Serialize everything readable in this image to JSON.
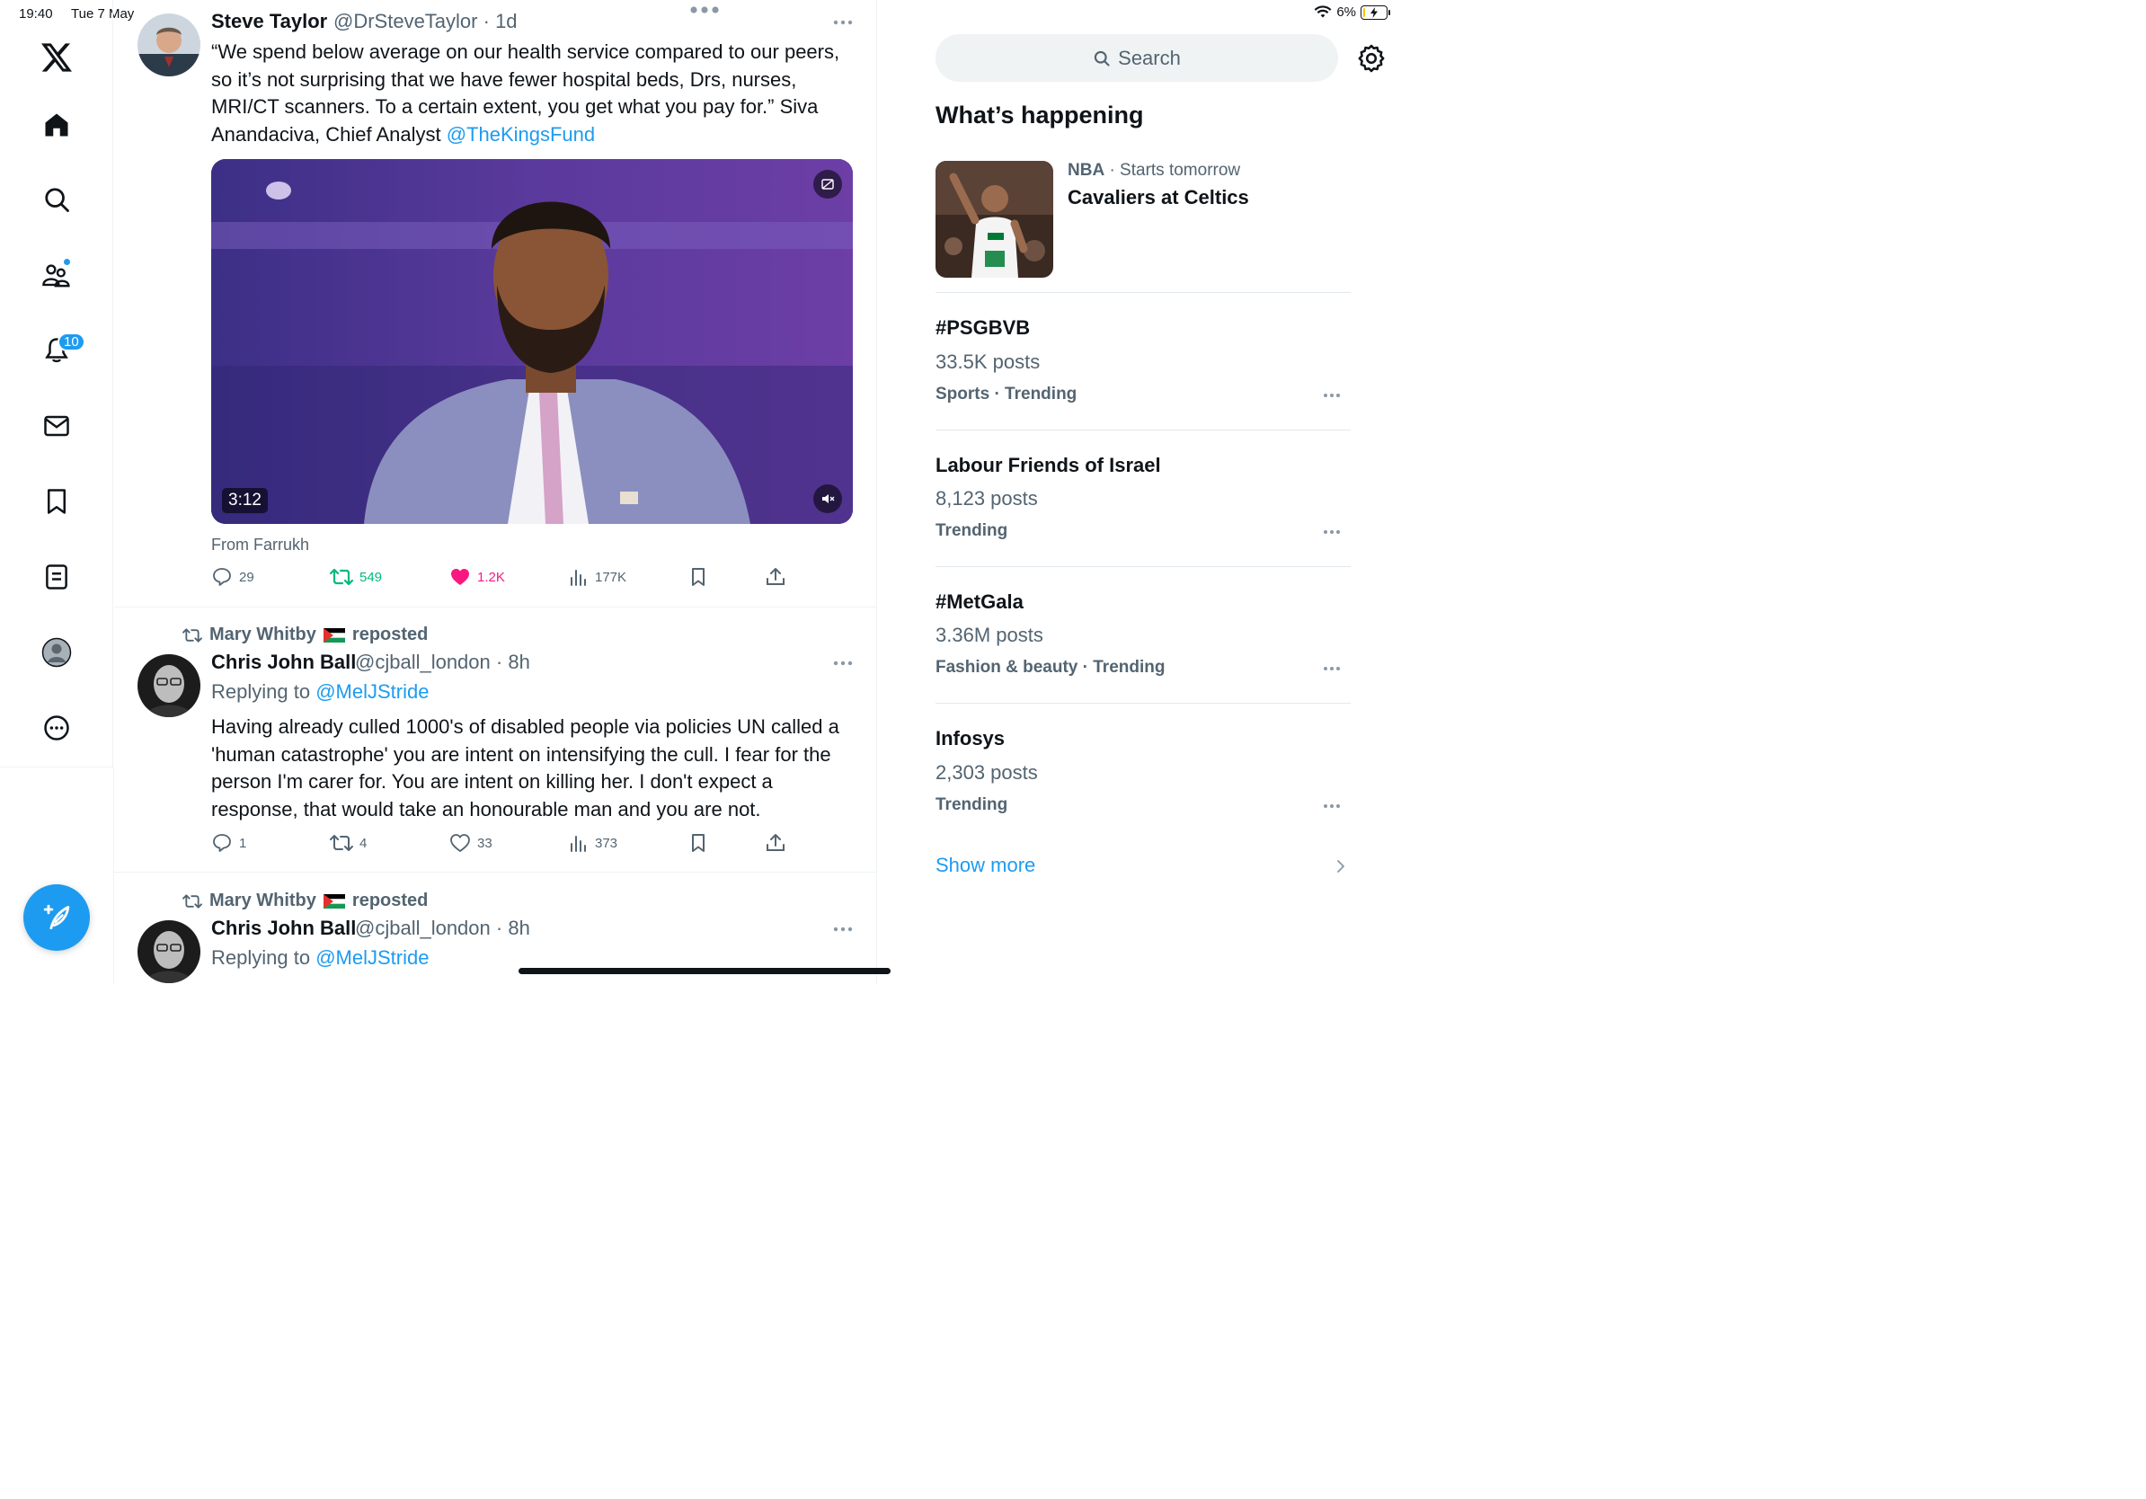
{
  "status_bar": {
    "time": "19:40",
    "date": "Tue 7 May",
    "battery_percent": "6%",
    "battery_level": 0.06
  },
  "nav": {
    "items": [
      "x-logo",
      "home",
      "explore",
      "communities",
      "notifications",
      "messages",
      "bookmarks",
      "lists",
      "profile",
      "more"
    ],
    "notifications_badge": "10"
  },
  "tweets": [
    {
      "name": "Steve Taylor",
      "handle": "@DrSteveTaylor",
      "time": "· 1d",
      "text": "“We spend below average on our health service compared to our peers, so it’s not surprising that we have fewer hospital beds, Drs, nurses, MRI/CT scanners. To a certain extent, you get what you pay for.” Siva Anandaciva, Chief Analyst ",
      "mention": "@TheKingsFund",
      "video_duration": "3:12",
      "from": "From Farrukh",
      "replies": "29",
      "reposts": "549",
      "likes": "1.2K",
      "views": "177K"
    },
    {
      "reposted_by": "Mary Whitby",
      "reposted_label": "reposted",
      "name": "Chris John Ball",
      "handle": "@cjball_london",
      "time": "· 8h",
      "replying_to_label": "Replying to ",
      "replying_to": "@MelJStride",
      "text": "Having already culled 1000's of disabled people via policies UN called a 'human catastrophe' you are intent on intensifying the cull. I fear for the person I'm carer for. You are intent on killing her. I don't expect a response, that would take an honourable man and you are not.",
      "replies": "1",
      "reposts": "4",
      "likes": "33",
      "views": "373"
    },
    {
      "reposted_by": "Mary Whitby",
      "reposted_label": "reposted",
      "name": "Chris John Ball",
      "handle": "@cjball_london",
      "time": "· 8h",
      "replying_to_label": "Replying to ",
      "replying_to": "@MelJStride"
    }
  ],
  "sidebar": {
    "search_placeholder": "Search",
    "heading": "What’s happening",
    "nba": {
      "category": "NBA",
      "context": " · Starts tomorrow",
      "title": "Cavaliers at Celtics"
    },
    "trends": [
      {
        "title": "#PSGBVB",
        "count": "33.5K posts",
        "context": "Sports · Trending"
      },
      {
        "title": "Labour Friends of Israel",
        "count": "8,123 posts",
        "context": "Trending"
      },
      {
        "title": "#MetGala",
        "count": "3.36M posts",
        "context": "Fashion & beauty · Trending"
      },
      {
        "title": "Infosys",
        "count": "2,303 posts",
        "context": "Trending"
      }
    ],
    "show_more": "Show more"
  },
  "colors": {
    "accent": "#1d9bf0",
    "repost_active": "#00ba7c",
    "like_active": "#f91880",
    "secondary_text": "#536471"
  }
}
